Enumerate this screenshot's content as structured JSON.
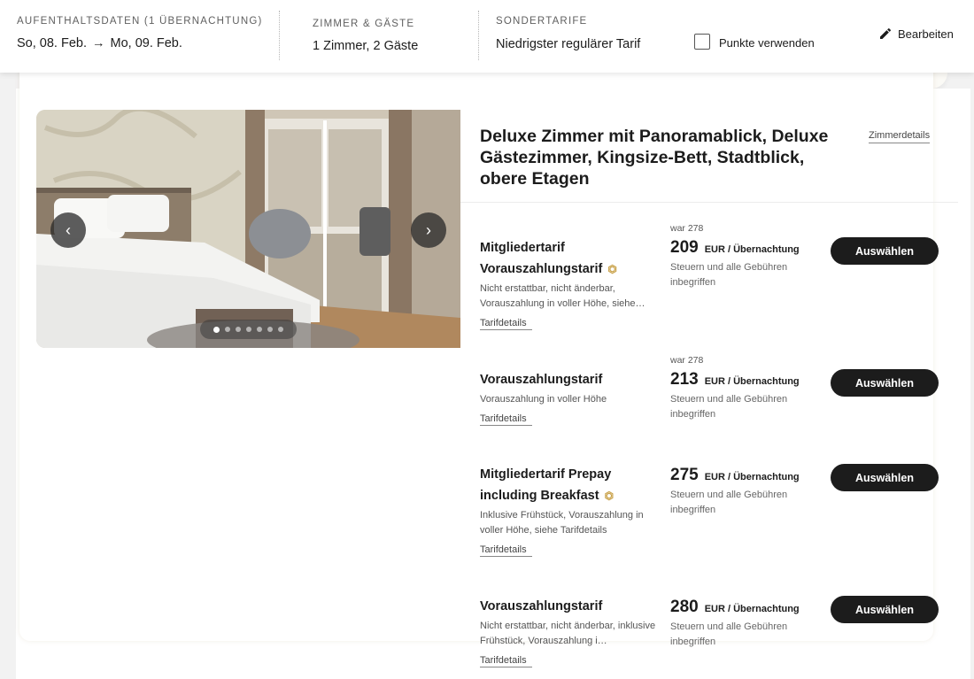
{
  "header": {
    "stay": {
      "label": "AUFENTHALTSDATEN (1 ÜBERNACHTUNG)",
      "from": "So, 08. Feb.",
      "arrow": "→",
      "to": "Mo, 09. Feb."
    },
    "rooms": {
      "label": "ZIMMER & GÄSTE",
      "value": "1 Zimmer, 2 Gäste"
    },
    "special": {
      "label": "SONDERTARIFE",
      "value": "Niedrigster regulärer Tarif"
    },
    "points_label": "Punkte verwenden",
    "edit_label": "Bearbeiten"
  },
  "room": {
    "title": "Deluxe Zimmer mit Panoramablick, Deluxe Gästezimmer, Kingsize-Bett, Stadtblick, obere Etagen",
    "details_link": "Zimmerdetails",
    "carousel": {
      "count": 7,
      "active": 0,
      "prev_icon": "chevron-left-icon",
      "next_icon": "chevron-right-icon"
    }
  },
  "rates": [
    {
      "name1": "Mitgliedertarif",
      "name2": "Vorauszahlungstarif",
      "has_tag": true,
      "desc": "Nicht erstattbar, nicht änderbar, Vorauszahlung in voller Höhe, siehe…",
      "link": "Tarifdetails",
      "was": "war 278",
      "price": "209",
      "unit": "EUR / Übernachtung",
      "tax": "Steuern und alle Gebühren inbegriffen",
      "button": "Auswählen"
    },
    {
      "name1": "Vorauszahlungstarif",
      "name2": "",
      "has_tag": false,
      "desc": "Vorauszahlung in voller Höhe",
      "link": "Tarifdetails",
      "was": "war 278",
      "price": "213",
      "unit": "EUR / Übernachtung",
      "tax": "Steuern und alle Gebühren inbegriffen",
      "button": "Auswählen"
    },
    {
      "name1": "Mitgliedertarif Prepay",
      "name2": "including Breakfast",
      "has_tag": true,
      "desc": "Inklusive Frühstück, Vorauszahlung in voller Höhe, siehe Tarifdetails",
      "link": "Tarifdetails",
      "was": "",
      "price": "275",
      "unit": "EUR / Übernachtung",
      "tax": "Steuern und alle Gebühren inbegriffen",
      "button": "Auswählen"
    },
    {
      "name1": "Vorauszahlungstarif",
      "name2": "",
      "has_tag": false,
      "desc": "Nicht erstattbar, nicht änderbar, inklusive Frühstück, Vorauszahlung i…",
      "link": "Tarifdetails",
      "was": "",
      "price": "280",
      "unit": "EUR / Übernachtung",
      "tax": "Steuern und alle Gebühren inbegriffen",
      "button": "Auswählen"
    }
  ],
  "colors": {
    "accent": "#1c1c1c",
    "tag": "#c9a24a",
    "background": "#f2f2f2"
  }
}
